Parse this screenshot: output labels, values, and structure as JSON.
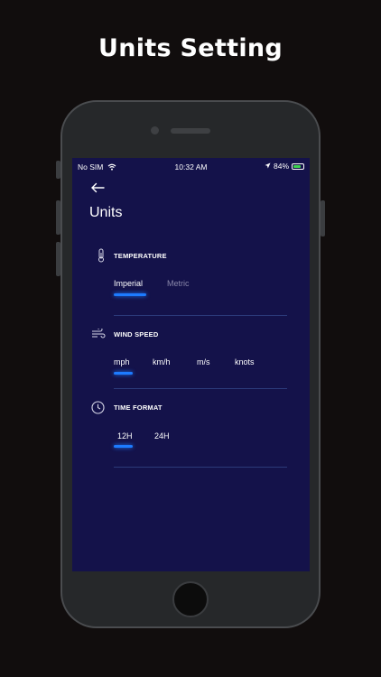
{
  "headline": "Units Setting",
  "status_bar": {
    "carrier": "No SIM",
    "time": "10:32 AM",
    "battery_percent": "84%"
  },
  "screen": {
    "title": "Units",
    "sections": [
      {
        "label": "TEMPERATURE",
        "icon": "thermometer-icon",
        "options": [
          "Imperial",
          "Metric"
        ],
        "selected": "Imperial"
      },
      {
        "label": "WIND SPEED",
        "icon": "wind-icon",
        "options": [
          "mph",
          "km/h",
          "m/s",
          "knots"
        ],
        "selected": "mph"
      },
      {
        "label": "TIME FORMAT",
        "icon": "clock-icon",
        "options": [
          "12H",
          "24H"
        ],
        "selected": "12H"
      }
    ]
  },
  "colors": {
    "background": "#110d0d",
    "screen": "#14124a",
    "accent": "#1d7bff"
  }
}
